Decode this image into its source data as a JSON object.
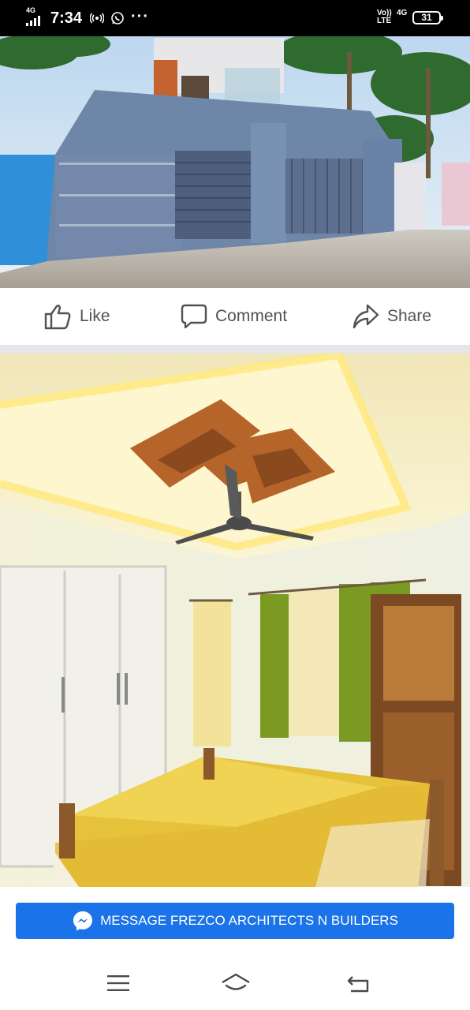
{
  "status_bar": {
    "network_type": "4G",
    "time": "7:34",
    "volte": "Vo)) LTE",
    "network_type_right": "4G",
    "battery_level": "31"
  },
  "post_actions": {
    "like_label": "Like",
    "comment_label": "Comment",
    "share_label": "Share"
  },
  "cta": {
    "message_label": "MESSAGE FREZCO ARCHITECTS N BUILDERS"
  },
  "icons": [
    "signal-icon",
    "hotspot-icon",
    "whatsapp-icon",
    "more-dots-icon",
    "battery-icon",
    "like-icon",
    "comment-icon",
    "share-icon",
    "messenger-icon",
    "menu-icon",
    "home-icon",
    "back-icon"
  ],
  "colors": {
    "button_blue": "#1a73e8",
    "action_text": "#505257",
    "separator": "#e4e6ea"
  }
}
